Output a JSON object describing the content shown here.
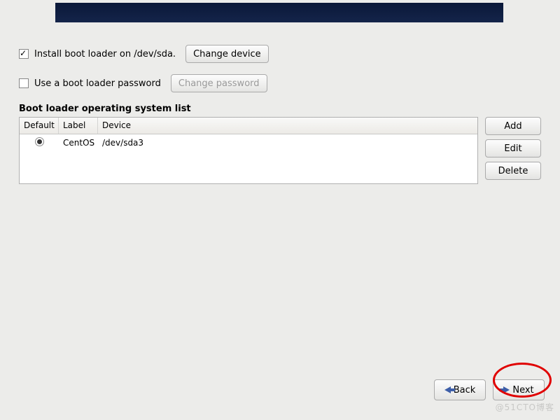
{
  "install_boot_loader": {
    "checked": true,
    "label": "Install boot loader on /dev/sda.",
    "button": "Change device"
  },
  "use_password": {
    "checked": false,
    "label": "Use a boot loader password",
    "button": "Change password"
  },
  "list_title": "Boot loader operating system list",
  "columns": {
    "c0": "Default",
    "c1": "Label",
    "c2": "Device"
  },
  "rows": [
    {
      "default": true,
      "label": "CentOS",
      "device": "/dev/sda3"
    }
  ],
  "buttons": {
    "add": "Add",
    "edit": "Edit",
    "delete": "Delete",
    "back": "Back",
    "next": "Next"
  },
  "watermark": "@51CTO博客"
}
